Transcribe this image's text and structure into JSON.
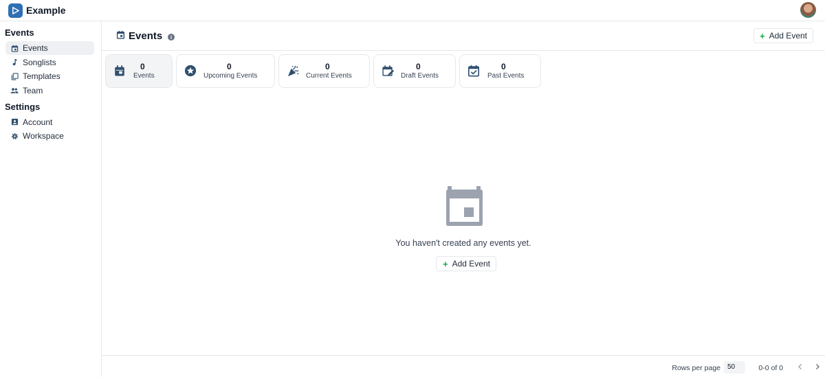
{
  "app": {
    "name": "Example"
  },
  "sidebar": {
    "sections": [
      {
        "heading": "Events",
        "items": [
          {
            "label": "Events",
            "icon": "calendar-icon",
            "active": true
          },
          {
            "label": "Songlists",
            "icon": "music-note-icon"
          },
          {
            "label": "Templates",
            "icon": "copy-icon"
          },
          {
            "label": "Team",
            "icon": "people-icon"
          }
        ]
      },
      {
        "heading": "Settings",
        "items": [
          {
            "label": "Account",
            "icon": "account-box-icon"
          },
          {
            "label": "Workspace",
            "icon": "gear-icon"
          }
        ]
      }
    ]
  },
  "header": {
    "title": "Events",
    "add_label": "Add Event"
  },
  "stats": [
    {
      "value": "0",
      "label": "Events",
      "icon": "calendar-icon"
    },
    {
      "value": "0",
      "label": "Upcoming Events",
      "icon": "star-icon"
    },
    {
      "value": "0",
      "label": "Current Events",
      "icon": "party-popper-icon"
    },
    {
      "value": "0",
      "label": "Draft Events",
      "icon": "calendar-edit-icon"
    },
    {
      "value": "0",
      "label": "Past Events",
      "icon": "calendar-check-icon"
    }
  ],
  "empty": {
    "message": "You haven't created any events yet.",
    "add_label": "Add Event"
  },
  "footer": {
    "rows_label": "Rows per page",
    "rows_value": "50",
    "range": "0-0 of 0"
  },
  "colors": {
    "accent": "#16a34a",
    "brand": "#2f6fb3",
    "icon": "#374151"
  }
}
